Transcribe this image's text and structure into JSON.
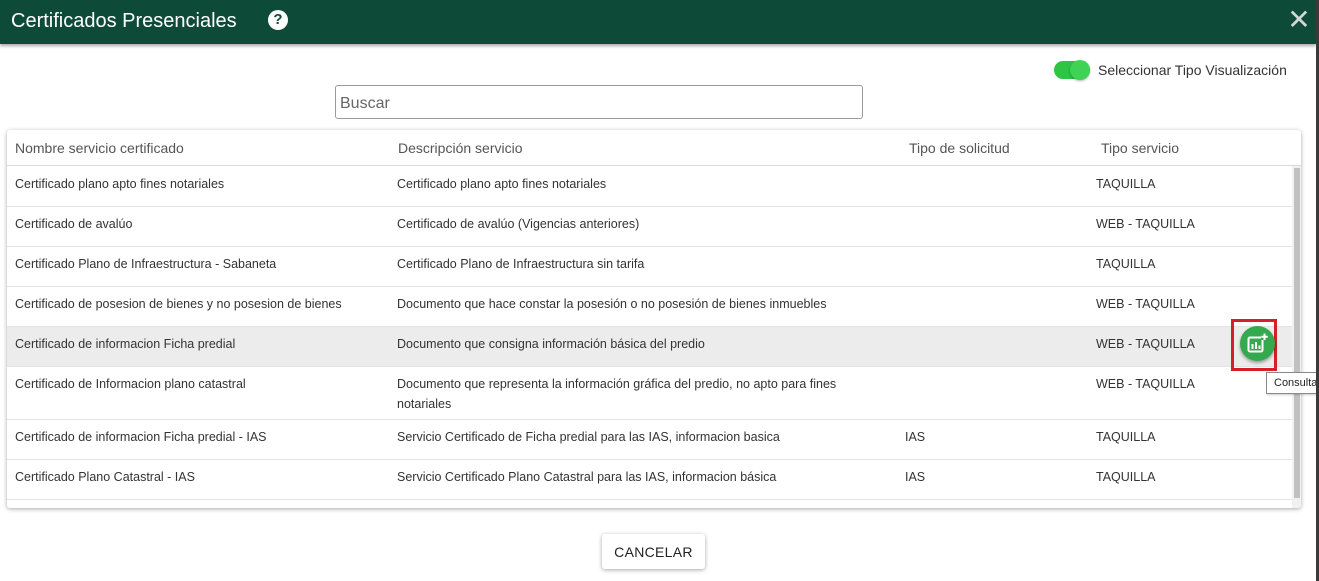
{
  "dialog": {
    "title": "Certificados Presenciales",
    "help_icon_glyph": "?",
    "close_icon_glyph": "✕"
  },
  "view_toggle": {
    "label": "Seleccionar Tipo Visualización",
    "enabled": true,
    "color": "#2ec444"
  },
  "search": {
    "placeholder": "Buscar",
    "value": ""
  },
  "table": {
    "columns": [
      "Nombre servicio certificado",
      "Descripción servicio",
      "Tipo de solicitud",
      "Tipo servicio"
    ],
    "rows": [
      {
        "name": "Certificado plano apto fines notariales",
        "description": "Certificado plano apto fines notariales",
        "request_type": "",
        "service_type": "TAQUILLA"
      },
      {
        "name": "Certificado de avalúo",
        "description": "Certificado de avalúo (Vigencias anteriores)",
        "request_type": "",
        "service_type": "WEB - TAQUILLA"
      },
      {
        "name": "Certificado Plano de Infraestructura - Sabaneta",
        "description": "Certificado Plano de Infraestructura sin tarifa",
        "request_type": "",
        "service_type": "TAQUILLA"
      },
      {
        "name": "Certificado de posesion de bienes y no posesion de bienes",
        "description": "Documento que hace constar la posesión o no posesión de bienes inmuebles",
        "request_type": "",
        "service_type": "WEB - TAQUILLA"
      },
      {
        "name": "Certificado de informacion Ficha predial",
        "description": "Documento que consigna información básica del predio",
        "request_type": "",
        "service_type": "WEB - TAQUILLA"
      },
      {
        "name": "Certificado de Informacion plano catastral",
        "description": "Documento que representa la información gráfica del predio, no apto para fines notariales",
        "request_type": "",
        "service_type": "WEB - TAQUILLA"
      },
      {
        "name": "Certificado de informacion Ficha predial - IAS",
        "description": "Servicio Certificado de Ficha predial para las IAS, informacion basica",
        "request_type": "IAS",
        "service_type": "TAQUILLA"
      },
      {
        "name": "Certificado Plano Catastral - IAS",
        "description": "Servicio Certificado Plano Catastral para las IAS, informacion básica",
        "request_type": "IAS",
        "service_type": "TAQUILLA"
      }
    ]
  },
  "row_action": {
    "icon": "add-chart-icon",
    "tooltip": "Consultar",
    "color": "#34a94f",
    "highlight_color": "#d71f2a"
  },
  "footer": {
    "cancel_label": "CANCELAR"
  },
  "colors": {
    "header_bg": "#0d4a37"
  }
}
